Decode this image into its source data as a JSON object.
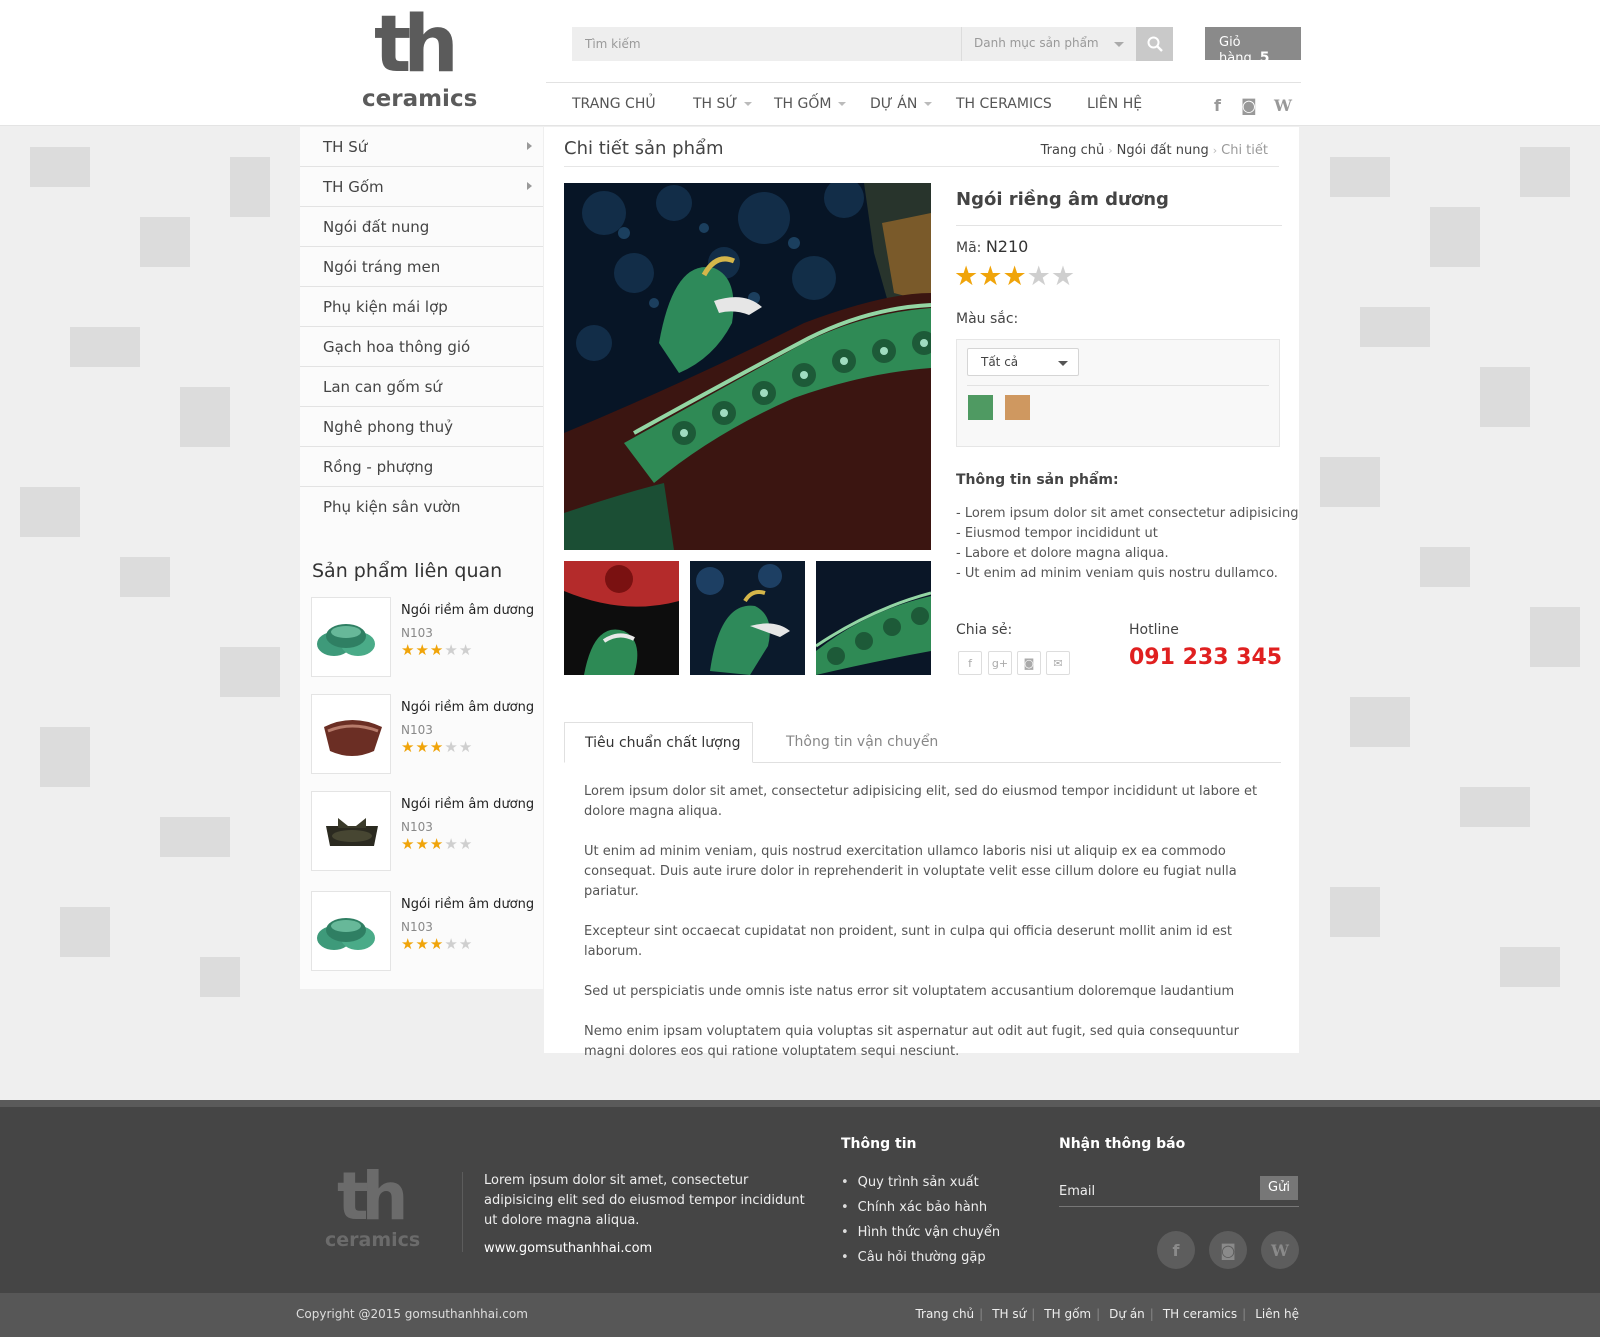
{
  "header": {
    "logo_top": "th",
    "logo_bottom": "ceramics",
    "search_placeholder": "Tìm kiếm",
    "category_label": "Danh mục sản phẩm",
    "cart_label": "Giỏ hàng",
    "cart_count": "5"
  },
  "nav": {
    "items": [
      "TRANG CHỦ",
      "TH SỨ",
      "TH GỐM",
      "DỰ ÁN",
      "TH CERAMICS",
      "LIÊN HỆ"
    ],
    "social": [
      "f",
      "◙",
      "W"
    ]
  },
  "sidebar": {
    "menu": [
      "TH Sứ",
      "TH Gốm",
      "Ngói đất nung",
      "Ngói tráng men",
      "Phụ kiện mái lợp",
      "Gạch hoa thông gió",
      "Lan can gốm sứ",
      "Nghê phong thuỷ",
      "Rồng - phượng",
      "Phụ kiện sân vườn"
    ],
    "related_title": "Sản phẩm liên quan",
    "related": [
      {
        "name": "Ngói riềm âm dương",
        "code": "N103",
        "rating": 3
      },
      {
        "name": "Ngói riềm âm dương",
        "code": "N103",
        "rating": 3
      },
      {
        "name": "Ngói riềm âm dương",
        "code": "N103",
        "rating": 3
      },
      {
        "name": "Ngói riềm âm dương",
        "code": "N103",
        "rating": 3
      }
    ]
  },
  "main": {
    "page_title": "Chi tiết sản phẩm",
    "breadcrumb": [
      "Trang chủ",
      "Ngói đất nung",
      "Chi tiết"
    ],
    "product_name": "Ngói riềng âm dương",
    "code_label": "Mã:",
    "code_value": "N210",
    "rating": 3,
    "color_label": "Màu sắc:",
    "color_select": "Tất cả",
    "swatches": [
      "#4f9a62",
      "#cf9860"
    ],
    "info_label": "Thông tin sản phẩm:",
    "info_items": [
      "- Lorem ipsum dolor sit amet consectetur adipisicing",
      "- Eiusmod tempor incididunt ut",
      "- Labore et dolore magna aliqua.",
      "- Ut enim ad minim veniam quis nostru dullamco."
    ],
    "share_label": "Chia sẻ:",
    "share_icons": [
      "f",
      "g+",
      "◙",
      "✉"
    ],
    "hotline_label": "Hotline",
    "hotline_number": "091 233 345",
    "tabs": [
      "Tiêu chuẩn chất lượng",
      "Thông tin vận chuyển"
    ],
    "tab_paragraphs": [
      "Lorem ipsum dolor sit amet, consectetur adipisicing elit, sed do eiusmod tempor incididunt ut labore et dolore magna aliqua.",
      "Ut enim ad minim veniam, quis nostrud exercitation ullamco laboris nisi ut aliquip ex ea commodo consequat. Duis aute irure dolor in reprehenderit in voluptate velit esse cillum dolore eu fugiat nulla pariatur.",
      "Excepteur sint occaecat cupidatat non proident, sunt in culpa qui officia deserunt mollit anim id est laborum.",
      "Sed ut perspiciatis unde omnis iste natus error sit voluptatem accusantium doloremque laudantium",
      "Nemo enim ipsam voluptatem quia voluptas sit aspernatur aut odit aut fugit, sed quia consequuntur magni dolores eos qui ratione voluptatem sequi nesciunt."
    ]
  },
  "footer": {
    "logo_top": "th",
    "logo_bottom": "ceramics",
    "desc": "Lorem ipsum dolor sit amet, consectetur adipisicing elit sed do eiusmod tempor incididunt ut dolore magna aliqua.",
    "site": "www.gomsuthanhhai.com",
    "info_title": "Thông tin",
    "info_links": [
      "Quy trình sản xuất",
      "Chính xác bảo hành",
      "Hình thức vận chuyển",
      "Câu hỏi thường gặp"
    ],
    "newsletter_title": "Nhận thông báo",
    "email_placeholder": "Email",
    "send_label": "Gửi",
    "social": [
      "f",
      "◙",
      "W"
    ],
    "copyright": "Copyright @2015 gomsuthanhhai.com",
    "bottom_links": [
      "Trang chủ",
      "TH sứ",
      "TH gốm",
      "Dự án",
      "TH ceramics",
      "Liên hệ"
    ]
  }
}
